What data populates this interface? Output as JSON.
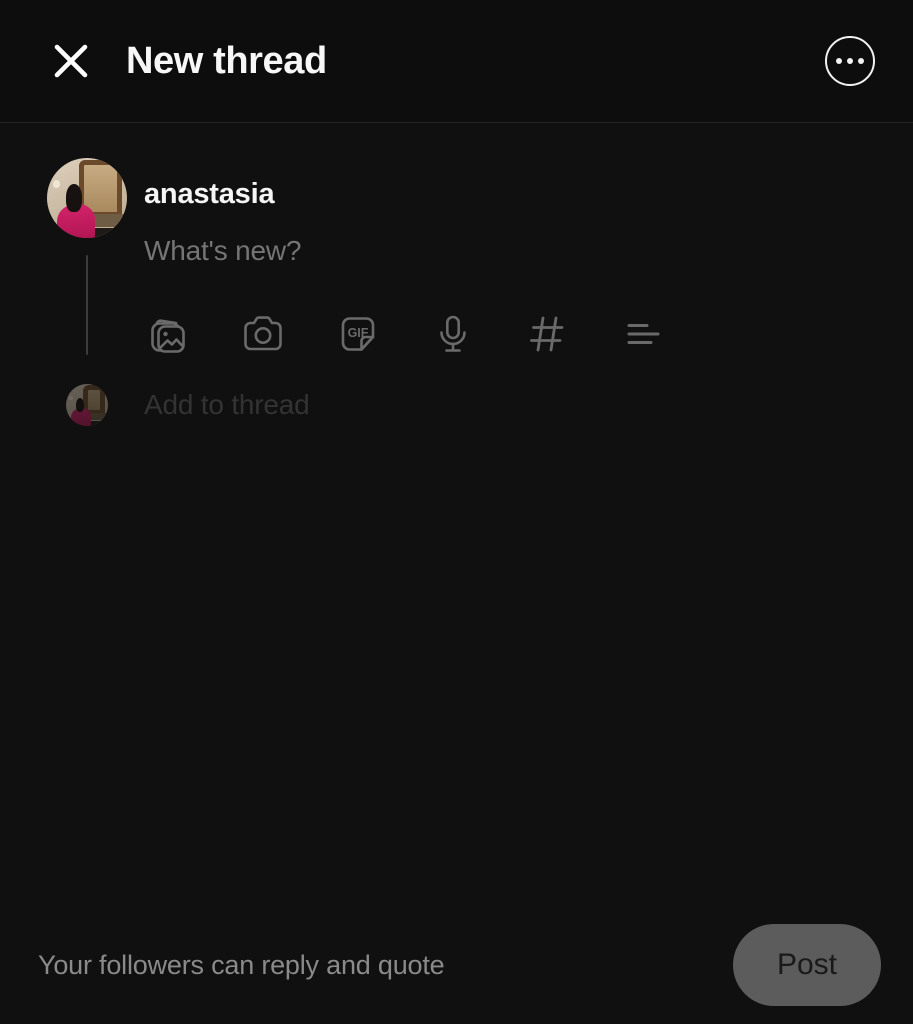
{
  "header": {
    "close_icon": "close-icon",
    "title": "New thread",
    "menu_icon": "more-options-icon"
  },
  "composer": {
    "username": "anastasia",
    "placeholder": "What's new?",
    "avatar_alt": "anastasia-avatar",
    "attachments": [
      {
        "name": "gallery-icon",
        "label": "Photo gallery"
      },
      {
        "name": "camera-icon",
        "label": "Camera"
      },
      {
        "name": "gif-icon",
        "label": "GIF",
        "text": "GIF"
      },
      {
        "name": "microphone-icon",
        "label": "Voice"
      },
      {
        "name": "hashtag-icon",
        "label": "Tag topic"
      },
      {
        "name": "poll-icon",
        "label": "Poll"
      }
    ],
    "add_to_thread": {
      "label": "Add to thread",
      "avatar_alt": "anastasia-avatar-small"
    }
  },
  "bottom_bar": {
    "audience": "Your followers can reply and quote",
    "post_label": "Post"
  },
  "colors": {
    "background": "#101010",
    "header_background": "#0d0d0d",
    "divider": "#232323",
    "primary_text": "#f5f5f5",
    "placeholder_text": "#757575",
    "muted_text": "#8a8a8a",
    "faded_text": "#333333",
    "icon": "#6a6a6a",
    "post_button_background": "#5c5c5c",
    "post_button_text": "#1a1a1a",
    "thread_line": "#3c3c3c"
  }
}
